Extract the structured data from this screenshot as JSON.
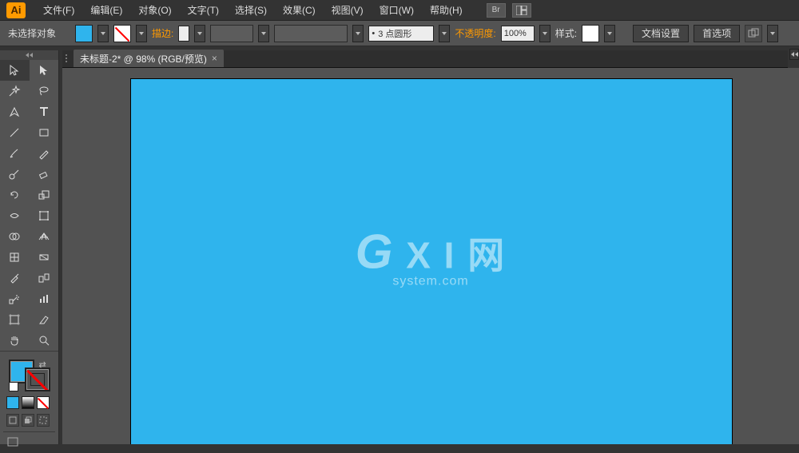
{
  "app_logo": "Ai",
  "menu": {
    "file": "文件(F)",
    "edit": "编辑(E)",
    "object": "对象(O)",
    "type": "文字(T)",
    "select": "选择(S)",
    "effect": "效果(C)",
    "view": "视图(V)",
    "window": "窗口(W)",
    "help": "帮助(H)"
  },
  "options": {
    "selection_status": "未选择对象",
    "stroke_label": "描边:",
    "stroke_weight": "",
    "profile_value": "3 点圆形",
    "profile_bullet": "•",
    "opacity_label": "不透明度:",
    "opacity_value": "100%",
    "style_label": "样式:",
    "doc_setup": "文档设置",
    "preferences": "首选项"
  },
  "tab": {
    "title": "未标题-2* @ 98% (RGB/预览)",
    "close": "×"
  },
  "colors": {
    "fill": "#2fb4ed",
    "artboard": "#2fb4ed",
    "accent": "#ff9a00"
  },
  "watermark": {
    "line1_a": "G",
    "line1_b": "X I",
    "line1_c": "网",
    "line2": "system.com"
  }
}
